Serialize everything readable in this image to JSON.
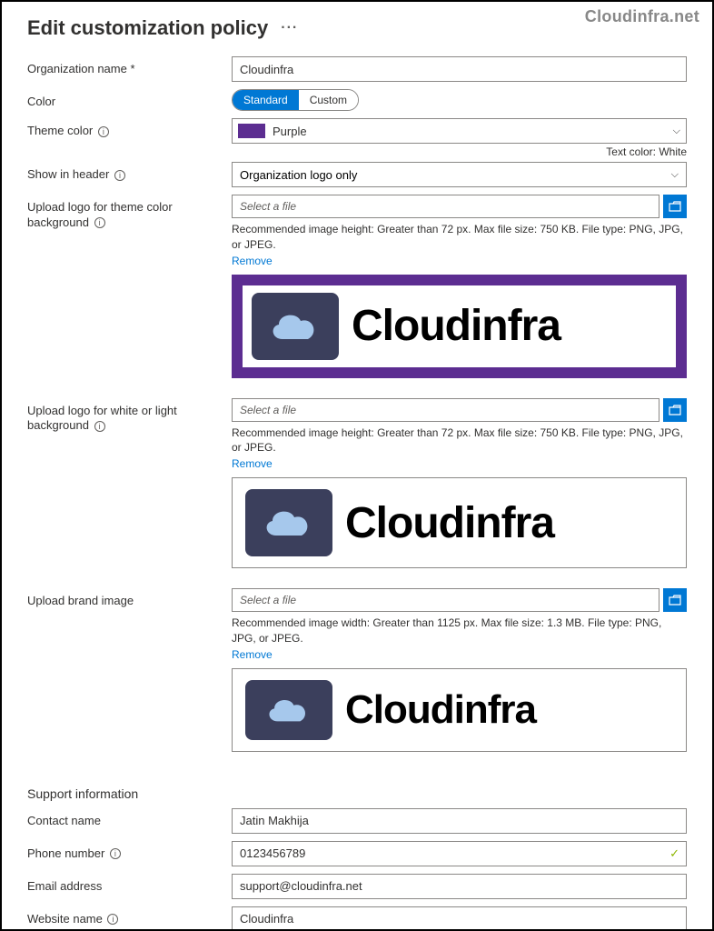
{
  "watermark": "Cloudinfra.net",
  "page_title": "Edit customization policy",
  "more_glyph": "···",
  "labels": {
    "org_name": "Organization name",
    "req_mark": "*",
    "color": "Color",
    "theme_color": "Theme color",
    "show_in_header": "Show in header",
    "upload_theme": "Upload logo for theme color background",
    "upload_light": "Upload logo for white or light background",
    "upload_brand": "Upload brand image",
    "support_info": "Support information",
    "contact_name": "Contact name",
    "phone_number": "Phone number",
    "email_address": "Email address",
    "website_name": "Website name"
  },
  "fields": {
    "org_name_value": "Cloudinfra",
    "color_std": "Standard",
    "color_custom": "Custom",
    "theme_color_value": "Purple",
    "text_color_note": "Text color: White",
    "show_in_header_value": "Organization logo only",
    "select_file_placeholder": "Select a file",
    "hint_logo": "Recommended image height: Greater than 72 px. Max file size: 750 KB. File type: PNG, JPG, or JPEG.",
    "hint_brand": "Recommended image width: Greater than 1125 px. Max file size: 1.3 MB. File type: PNG, JPG, or JPEG.",
    "remove": "Remove",
    "brand_preview": "Cloudinfra",
    "contact_name_value": "Jatin Makhija",
    "phone_value": "0123456789",
    "email_value": "support@cloudinfra.net",
    "website_value": "Cloudinfra"
  }
}
